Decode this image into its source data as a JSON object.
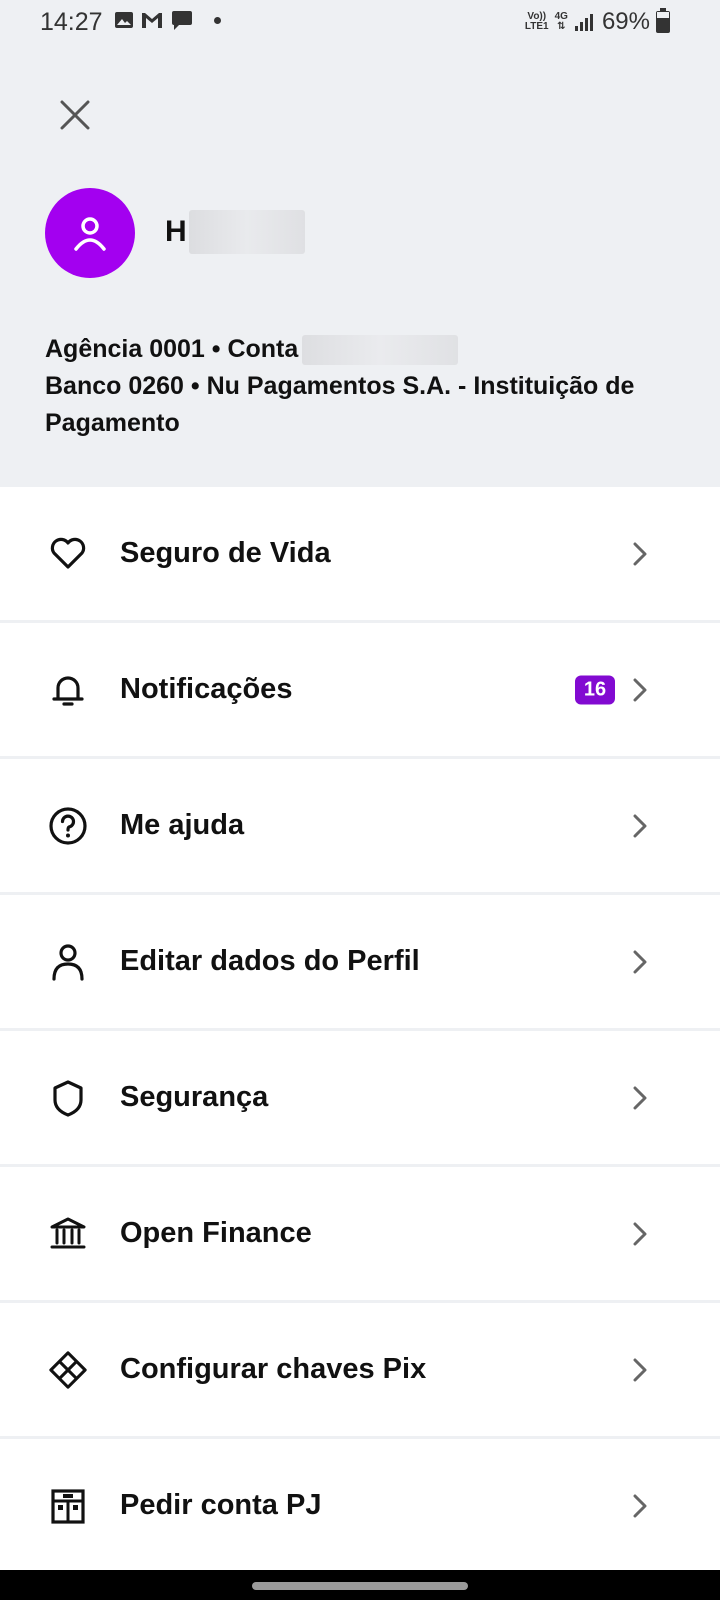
{
  "status_bar": {
    "time": "14:27",
    "network_top": "Vo))",
    "network_bottom": "LTE1",
    "network_type": "4G",
    "battery": "69%"
  },
  "header": {
    "close_icon": "close-icon",
    "user_name_initial": "H",
    "account_line_prefix": "Agência 0001 • Conta",
    "bank_line": "Banco 0260 • Nu Pagamentos S.A. - Instituição de Pagamento",
    "avatar_color": "#a300f0"
  },
  "menu": {
    "items": [
      {
        "label": "Seguro de Vida",
        "icon": "heart-icon"
      },
      {
        "label": "Notificações",
        "icon": "bell-icon",
        "badge": "16"
      },
      {
        "label": "Me ajuda",
        "icon": "help-circle-icon"
      },
      {
        "label": "Editar dados do Perfil",
        "icon": "person-icon"
      },
      {
        "label": "Segurança",
        "icon": "shield-icon"
      },
      {
        "label": "Open Finance",
        "icon": "bank-icon"
      },
      {
        "label": "Configurar chaves Pix",
        "icon": "pix-icon"
      },
      {
        "label": "Pedir conta PJ",
        "icon": "building-icon"
      }
    ]
  },
  "colors": {
    "accent": "#820ad1",
    "header_bg": "#eef0f3"
  }
}
